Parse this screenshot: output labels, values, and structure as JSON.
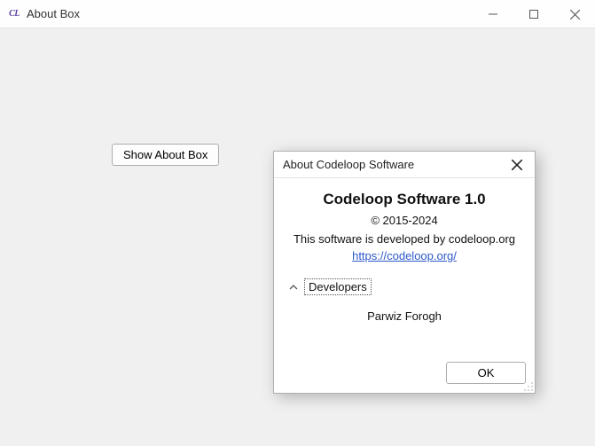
{
  "window": {
    "title": "About Box",
    "icon_text": "CL"
  },
  "main": {
    "show_button_label": "Show About Box"
  },
  "dialog": {
    "title": "About Codeloop Software",
    "app_title": "Codeloop Software 1.0",
    "copyright": "© 2015-2024",
    "description": "This software is developed by codeloop.org",
    "link": "https://codeloop.org/",
    "developers_label": "Developers",
    "developers": [
      "Parwiz Forogh"
    ],
    "ok_label": "OK"
  }
}
